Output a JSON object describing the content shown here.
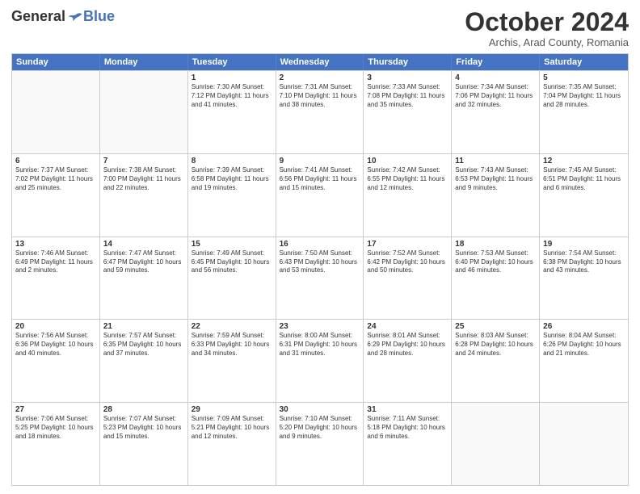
{
  "header": {
    "logo_general": "General",
    "logo_blue": "Blue",
    "month_title": "October 2024",
    "subtitle": "Archis, Arad County, Romania"
  },
  "days_of_week": [
    "Sunday",
    "Monday",
    "Tuesday",
    "Wednesday",
    "Thursday",
    "Friday",
    "Saturday"
  ],
  "weeks": [
    [
      {
        "day": "",
        "info": ""
      },
      {
        "day": "",
        "info": ""
      },
      {
        "day": "1",
        "info": "Sunrise: 7:30 AM\nSunset: 7:12 PM\nDaylight: 11 hours and 41 minutes."
      },
      {
        "day": "2",
        "info": "Sunrise: 7:31 AM\nSunset: 7:10 PM\nDaylight: 11 hours and 38 minutes."
      },
      {
        "day": "3",
        "info": "Sunrise: 7:33 AM\nSunset: 7:08 PM\nDaylight: 11 hours and 35 minutes."
      },
      {
        "day": "4",
        "info": "Sunrise: 7:34 AM\nSunset: 7:06 PM\nDaylight: 11 hours and 32 minutes."
      },
      {
        "day": "5",
        "info": "Sunrise: 7:35 AM\nSunset: 7:04 PM\nDaylight: 11 hours and 28 minutes."
      }
    ],
    [
      {
        "day": "6",
        "info": "Sunrise: 7:37 AM\nSunset: 7:02 PM\nDaylight: 11 hours and 25 minutes."
      },
      {
        "day": "7",
        "info": "Sunrise: 7:38 AM\nSunset: 7:00 PM\nDaylight: 11 hours and 22 minutes."
      },
      {
        "day": "8",
        "info": "Sunrise: 7:39 AM\nSunset: 6:58 PM\nDaylight: 11 hours and 19 minutes."
      },
      {
        "day": "9",
        "info": "Sunrise: 7:41 AM\nSunset: 6:56 PM\nDaylight: 11 hours and 15 minutes."
      },
      {
        "day": "10",
        "info": "Sunrise: 7:42 AM\nSunset: 6:55 PM\nDaylight: 11 hours and 12 minutes."
      },
      {
        "day": "11",
        "info": "Sunrise: 7:43 AM\nSunset: 6:53 PM\nDaylight: 11 hours and 9 minutes."
      },
      {
        "day": "12",
        "info": "Sunrise: 7:45 AM\nSunset: 6:51 PM\nDaylight: 11 hours and 6 minutes."
      }
    ],
    [
      {
        "day": "13",
        "info": "Sunrise: 7:46 AM\nSunset: 6:49 PM\nDaylight: 11 hours and 2 minutes."
      },
      {
        "day": "14",
        "info": "Sunrise: 7:47 AM\nSunset: 6:47 PM\nDaylight: 10 hours and 59 minutes."
      },
      {
        "day": "15",
        "info": "Sunrise: 7:49 AM\nSunset: 6:45 PM\nDaylight: 10 hours and 56 minutes."
      },
      {
        "day": "16",
        "info": "Sunrise: 7:50 AM\nSunset: 6:43 PM\nDaylight: 10 hours and 53 minutes."
      },
      {
        "day": "17",
        "info": "Sunrise: 7:52 AM\nSunset: 6:42 PM\nDaylight: 10 hours and 50 minutes."
      },
      {
        "day": "18",
        "info": "Sunrise: 7:53 AM\nSunset: 6:40 PM\nDaylight: 10 hours and 46 minutes."
      },
      {
        "day": "19",
        "info": "Sunrise: 7:54 AM\nSunset: 6:38 PM\nDaylight: 10 hours and 43 minutes."
      }
    ],
    [
      {
        "day": "20",
        "info": "Sunrise: 7:56 AM\nSunset: 6:36 PM\nDaylight: 10 hours and 40 minutes."
      },
      {
        "day": "21",
        "info": "Sunrise: 7:57 AM\nSunset: 6:35 PM\nDaylight: 10 hours and 37 minutes."
      },
      {
        "day": "22",
        "info": "Sunrise: 7:59 AM\nSunset: 6:33 PM\nDaylight: 10 hours and 34 minutes."
      },
      {
        "day": "23",
        "info": "Sunrise: 8:00 AM\nSunset: 6:31 PM\nDaylight: 10 hours and 31 minutes."
      },
      {
        "day": "24",
        "info": "Sunrise: 8:01 AM\nSunset: 6:29 PM\nDaylight: 10 hours and 28 minutes."
      },
      {
        "day": "25",
        "info": "Sunrise: 8:03 AM\nSunset: 6:28 PM\nDaylight: 10 hours and 24 minutes."
      },
      {
        "day": "26",
        "info": "Sunrise: 8:04 AM\nSunset: 6:26 PM\nDaylight: 10 hours and 21 minutes."
      }
    ],
    [
      {
        "day": "27",
        "info": "Sunrise: 7:06 AM\nSunset: 5:25 PM\nDaylight: 10 hours and 18 minutes."
      },
      {
        "day": "28",
        "info": "Sunrise: 7:07 AM\nSunset: 5:23 PM\nDaylight: 10 hours and 15 minutes."
      },
      {
        "day": "29",
        "info": "Sunrise: 7:09 AM\nSunset: 5:21 PM\nDaylight: 10 hours and 12 minutes."
      },
      {
        "day": "30",
        "info": "Sunrise: 7:10 AM\nSunset: 5:20 PM\nDaylight: 10 hours and 9 minutes."
      },
      {
        "day": "31",
        "info": "Sunrise: 7:11 AM\nSunset: 5:18 PM\nDaylight: 10 hours and 6 minutes."
      },
      {
        "day": "",
        "info": ""
      },
      {
        "day": "",
        "info": ""
      }
    ]
  ]
}
